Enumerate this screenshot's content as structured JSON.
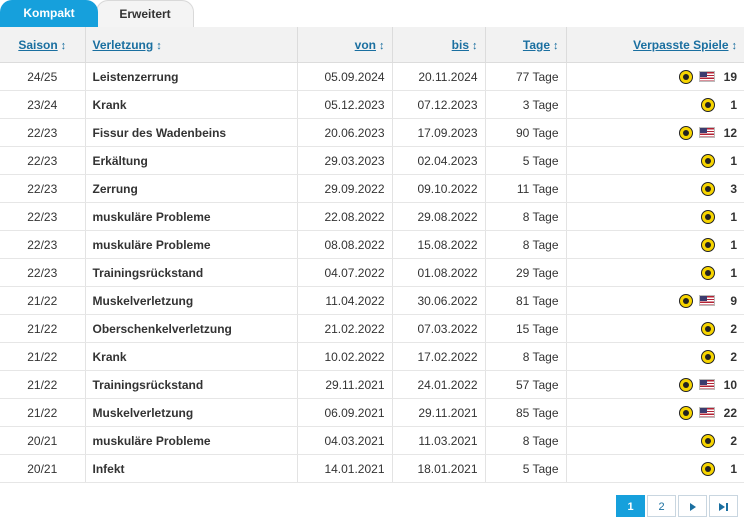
{
  "tabs": [
    {
      "label": "Kompakt",
      "active": true
    },
    {
      "label": "Erweitert",
      "active": false
    }
  ],
  "table": {
    "headers": {
      "season": "Saison",
      "injury": "Verletzung",
      "from": "von",
      "until": "bis",
      "days": "Tage",
      "games_missed": "Verpasste Spiele"
    },
    "rows": [
      {
        "season": "24/25",
        "injury": "Leistenzerrung",
        "from": "05.09.2024",
        "until": "20.11.2024",
        "days": "77 Tage",
        "games": "19",
        "flag": true
      },
      {
        "season": "23/24",
        "injury": "Krank",
        "from": "05.12.2023",
        "until": "07.12.2023",
        "days": "3 Tage",
        "games": "1",
        "flag": false
      },
      {
        "season": "22/23",
        "injury": "Fissur des Wadenbeins",
        "from": "20.06.2023",
        "until": "17.09.2023",
        "days": "90 Tage",
        "games": "12",
        "flag": true
      },
      {
        "season": "22/23",
        "injury": "Erkältung",
        "from": "29.03.2023",
        "until": "02.04.2023",
        "days": "5 Tage",
        "games": "1",
        "flag": false
      },
      {
        "season": "22/23",
        "injury": "Zerrung",
        "from": "29.09.2022",
        "until": "09.10.2022",
        "days": "11 Tage",
        "games": "3",
        "flag": false
      },
      {
        "season": "22/23",
        "injury": "muskuläre Probleme",
        "from": "22.08.2022",
        "until": "29.08.2022",
        "days": "8 Tage",
        "games": "1",
        "flag": false
      },
      {
        "season": "22/23",
        "injury": "muskuläre Probleme",
        "from": "08.08.2022",
        "until": "15.08.2022",
        "days": "8 Tage",
        "games": "1",
        "flag": false
      },
      {
        "season": "22/23",
        "injury": "Trainingsrückstand",
        "from": "04.07.2022",
        "until": "01.08.2022",
        "days": "29 Tage",
        "games": "1",
        "flag": false
      },
      {
        "season": "21/22",
        "injury": "Muskelverletzung",
        "from": "11.04.2022",
        "until": "30.06.2022",
        "days": "81 Tage",
        "games": "9",
        "flag": true
      },
      {
        "season": "21/22",
        "injury": "Oberschenkelverletzung",
        "from": "21.02.2022",
        "until": "07.03.2022",
        "days": "15 Tage",
        "games": "2",
        "flag": false
      },
      {
        "season": "21/22",
        "injury": "Krank",
        "from": "10.02.2022",
        "until": "17.02.2022",
        "days": "8 Tage",
        "games": "2",
        "flag": false
      },
      {
        "season": "21/22",
        "injury": "Trainingsrückstand",
        "from": "29.11.2021",
        "until": "24.01.2022",
        "days": "57 Tage",
        "games": "10",
        "flag": true
      },
      {
        "season": "21/22",
        "injury": "Muskelverletzung",
        "from": "06.09.2021",
        "until": "29.11.2021",
        "days": "85 Tage",
        "games": "22",
        "flag": true
      },
      {
        "season": "20/21",
        "injury": "muskuläre Probleme",
        "from": "04.03.2021",
        "until": "11.03.2021",
        "days": "8 Tage",
        "games": "2",
        "flag": false
      },
      {
        "season": "20/21",
        "injury": "Infekt",
        "from": "14.01.2021",
        "until": "18.01.2021",
        "days": "5 Tage",
        "games": "1",
        "flag": false
      }
    ]
  },
  "pagination": {
    "pages": [
      "1",
      "2"
    ],
    "current": "1"
  },
  "colors": {
    "accent": "#16a0dc",
    "link": "#1a6fa0"
  }
}
